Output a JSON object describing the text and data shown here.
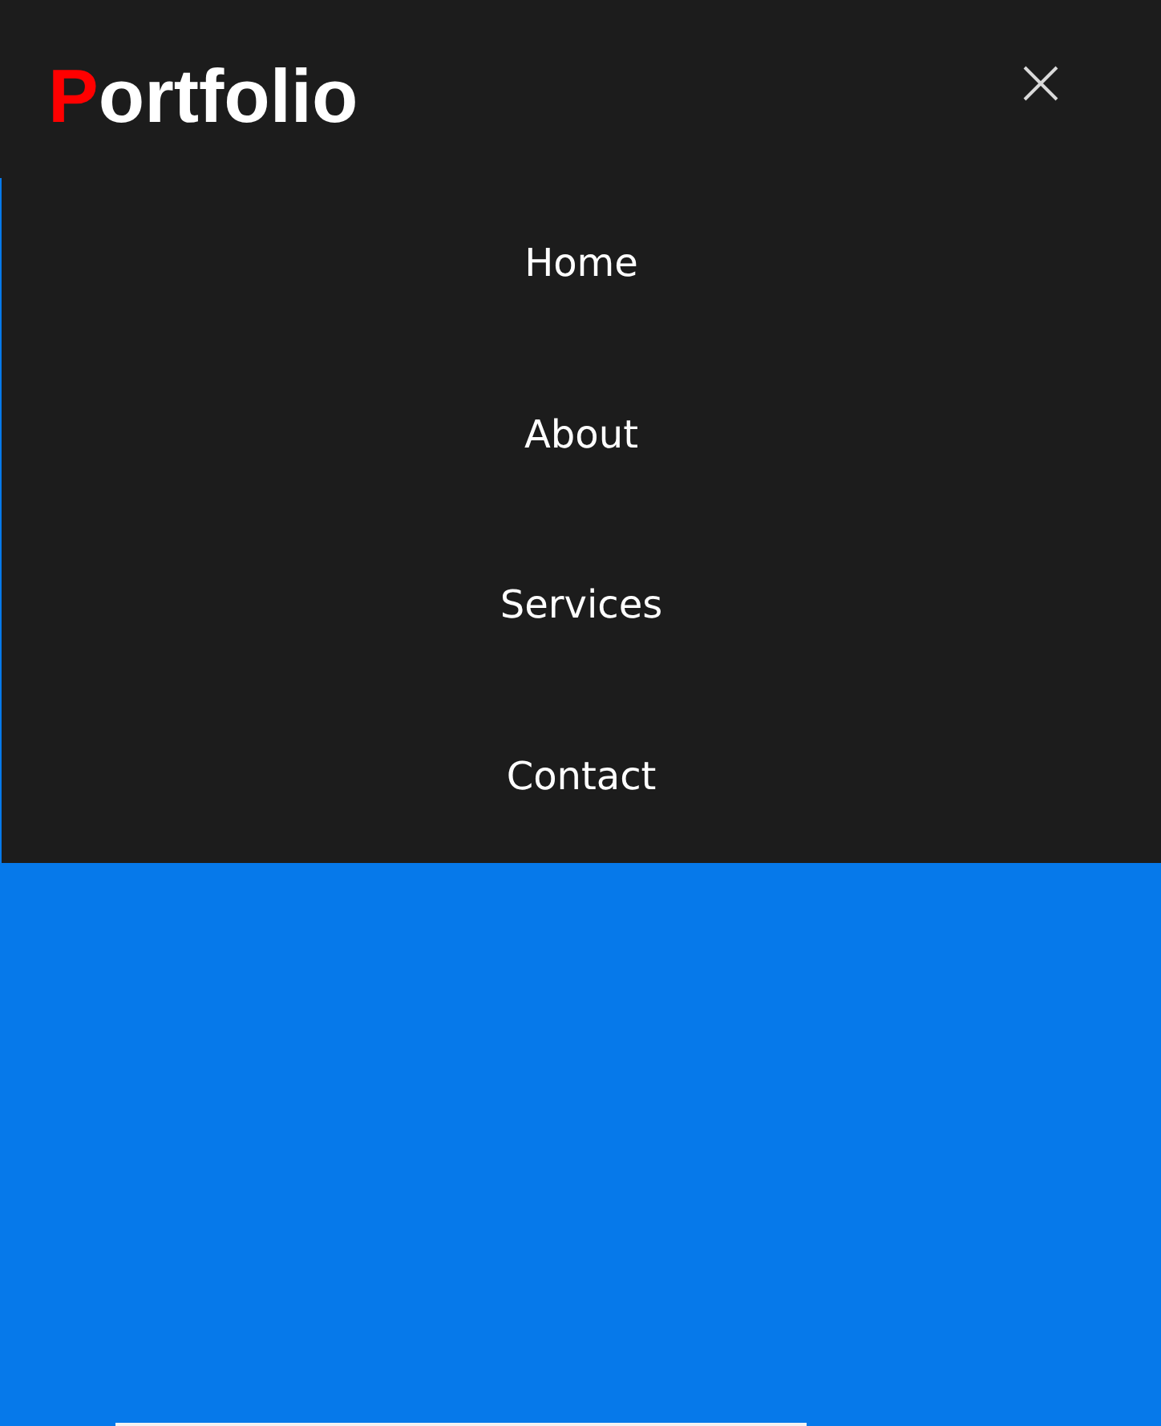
{
  "header": {
    "logo": {
      "accent": "P",
      "text": "ortfolio"
    }
  },
  "nav": {
    "links": [
      {
        "label": "Home"
      },
      {
        "label": "About"
      },
      {
        "label": "Services"
      },
      {
        "label": "Contact"
      }
    ]
  }
}
